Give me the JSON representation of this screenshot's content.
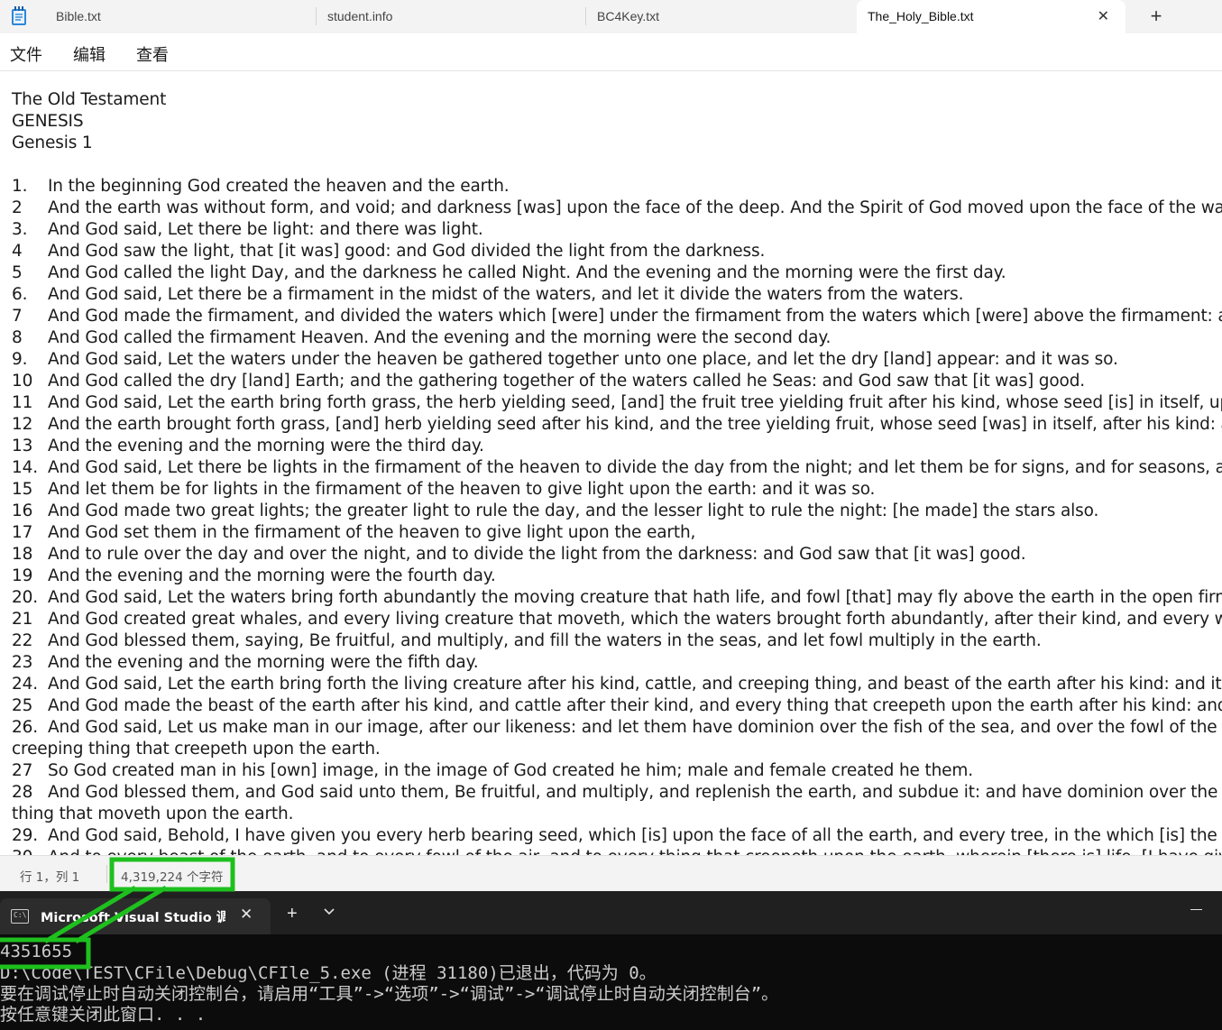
{
  "notepad": {
    "tabs": [
      {
        "label": "Bible.txt",
        "active": false
      },
      {
        "label": "student.info",
        "active": false
      },
      {
        "label": "BC4Key.txt",
        "active": false
      },
      {
        "label": "The_Holy_Bible.txt",
        "active": true
      }
    ],
    "close_glyph": "✕",
    "new_tab_glyph": "+",
    "menu": {
      "file": "文件",
      "edit": "编辑",
      "view": "查看"
    },
    "header_lines": [
      "The Old Testament",
      "GENESIS",
      "Genesis 1"
    ],
    "verses": [
      {
        "num": "1.",
        "text": "In the beginning God created the heaven and the earth."
      },
      {
        "num": "2",
        "text": "And the earth was without form, and void; and darkness [was] upon the face of the deep. And the Spirit of God moved upon the face of the waters."
      },
      {
        "num": "3.",
        "text": "And God said, Let there be light: and there was light."
      },
      {
        "num": "4",
        "text": "And God saw the light, that [it was] good: and God divided the light from the darkness."
      },
      {
        "num": "5",
        "text": "And God called the light Day, and the darkness he called Night. And the evening and the morning were the first day."
      },
      {
        "num": "6.",
        "text": "And God said, Let there be a firmament in the midst of the waters, and let it divide the waters from the waters."
      },
      {
        "num": "7",
        "text": "And God made the firmament, and divided the waters which [were] under the firmament from the waters which [were] above the firmament: and it was"
      },
      {
        "num": "8",
        "text": "And God called the firmament Heaven. And the evening and the morning were the second day."
      },
      {
        "num": "9.",
        "text": "And God said, Let the waters under the heaven be gathered together unto one place, and let the dry [land] appear: and it was so."
      },
      {
        "num": "10",
        "text": "And God called the dry [land] Earth; and the gathering together of the waters called he Seas: and God saw that [it was] good."
      },
      {
        "num": "11",
        "text": "And God said, Let the earth bring forth grass, the herb yielding seed, [and] the fruit tree yielding fruit after his kind, whose seed [is] in itself, upon the e"
      },
      {
        "num": "12",
        "text": "And the earth brought forth grass, [and] herb yielding seed after his kind, and the tree yielding fruit, whose seed [was] in itself, after his kind: and God"
      },
      {
        "num": "13",
        "text": "And the evening and the morning were the third day."
      },
      {
        "num": "14.",
        "text": "And God said, Let there be lights in the firmament of the heaven to divide the day from the night; and let them be for signs, and for seasons, and for d"
      },
      {
        "num": "15",
        "text": "And let them be for lights in the firmament of the heaven to give light upon the earth: and it was so."
      },
      {
        "num": "16",
        "text": "And God made two great lights; the greater light to rule the day, and the lesser light to rule the night: [he made] the stars also."
      },
      {
        "num": "17",
        "text": "And God set them in the firmament of the heaven to give light upon the earth,"
      },
      {
        "num": "18",
        "text": "And to rule over the day and over the night, and to divide the light from the darkness: and God saw that [it was] good."
      },
      {
        "num": "19",
        "text": "And the evening and the morning were the fourth day."
      },
      {
        "num": "20.",
        "text": "And God said, Let the waters bring forth abundantly the moving creature that hath life, and fowl [that] may fly above the earth in the open firmament o"
      },
      {
        "num": "21",
        "text": "And God created great whales, and every living creature that moveth, which the waters brought forth abundantly, after their kind, and every winged fo"
      },
      {
        "num": "22",
        "text": "And God blessed them, saying, Be fruitful, and multiply, and fill the waters in the seas, and let fowl multiply in the earth."
      },
      {
        "num": "23",
        "text": "And the evening and the morning were the fifth day."
      },
      {
        "num": "24.",
        "text": "And God said, Let the earth bring forth the living creature after his kind, cattle, and creeping thing, and beast of the earth after his kind: and it was so."
      },
      {
        "num": "25",
        "text": "And God made the beast of the earth after his kind, and cattle after their kind, and every thing that creepeth upon the earth after his kind: and God saw"
      },
      {
        "num": "26.",
        "text": "And God said, Let us make man in our image, after our likeness: and let them have dominion over the fish of the sea, and over the fowl of the air, and o"
      },
      {
        "num": "",
        "text": "creeping thing that creepeth upon the earth.",
        "continuation": true
      },
      {
        "num": "27",
        "text": "So God created man in his [own] image, in the image of God created he him; male and female created he them."
      },
      {
        "num": "28",
        "text": "And God blessed them, and God said unto them, Be fruitful, and multiply, and replenish the earth, and subdue it: and have dominion over the fish of t"
      },
      {
        "num": "",
        "text": "thing that moveth upon the earth.",
        "continuation": true
      },
      {
        "num": "29.",
        "text": "And God said, Behold, I have given you every herb bearing seed, which [is] upon the face of all the earth, and every tree, in the which [is] the fruit of a tr"
      },
      {
        "num": "30",
        "text": "And to every beast of the earth, and to every fowl of the air, and to every thing that creepeth upon the earth, wherein [there is] life, [I have given]"
      }
    ],
    "status": {
      "position": "行 1，列 1",
      "char_count": "4,319,224 个字符"
    }
  },
  "terminal": {
    "tab_title": "Microsoft Visual Studio 调试控制台",
    "icon_text": "C:\\",
    "close_glyph": "✕",
    "new_tab_glyph": "+",
    "lines": [
      "4351655",
      "D:\\Code\\TEST\\CFile\\Debug\\CFIle_5.exe (进程 31180)已退出，代码为 0。",
      "要在调试停止时自动关闭控制台，请启用“工具”->“选项”->“调试”->“调试停止时自动关闭控制台”。",
      "按任意键关闭此窗口. . ."
    ]
  },
  "colors": {
    "annotation": "#1ec01e",
    "terminal_bg": "#0c0c0c",
    "terminal_text": "#cccccc",
    "tabbar_bg": "#f3f3f3"
  }
}
